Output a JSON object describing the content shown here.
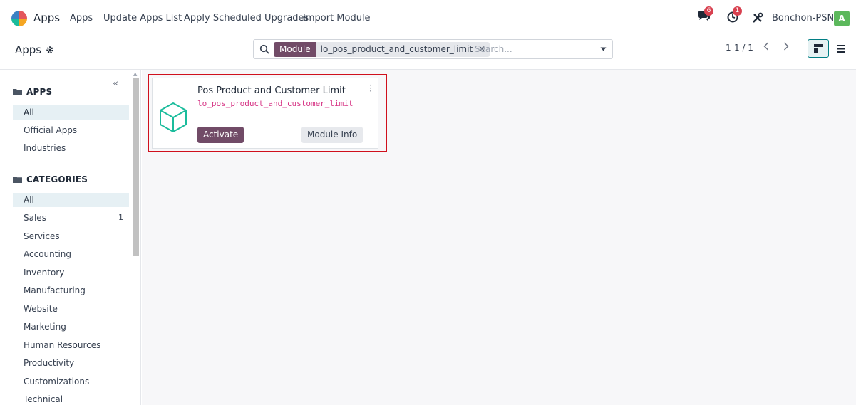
{
  "navbar": {
    "brand": "Apps",
    "menu": [
      "Apps",
      "Update Apps List",
      "Apply Scheduled Upgrades",
      "Import Module"
    ],
    "messages_badge": "6",
    "activities_badge": "1",
    "company": "Bonchon-PSN",
    "avatar_letter": "A"
  },
  "control": {
    "breadcrumb": "Apps",
    "search": {
      "facet_label": "Module",
      "facet_value": "lo_pos_product_and_customer_limit",
      "placeholder": "Search..."
    },
    "pager": "1-1 / 1"
  },
  "sidebar": {
    "apps_title": "APPS",
    "apps_items": [
      "All",
      "Official Apps",
      "Industries"
    ],
    "categories_title": "CATEGORIES",
    "category_items": [
      {
        "label": "All",
        "count": ""
      },
      {
        "label": "Sales",
        "count": "1"
      },
      {
        "label": "Services",
        "count": ""
      },
      {
        "label": "Accounting",
        "count": ""
      },
      {
        "label": "Inventory",
        "count": ""
      },
      {
        "label": "Manufacturing",
        "count": ""
      },
      {
        "label": "Website",
        "count": ""
      },
      {
        "label": "Marketing",
        "count": ""
      },
      {
        "label": "Human Resources",
        "count": ""
      },
      {
        "label": "Productivity",
        "count": ""
      },
      {
        "label": "Customizations",
        "count": ""
      },
      {
        "label": "Technical",
        "count": ""
      }
    ]
  },
  "card": {
    "title": "Pos Product and Customer Limit",
    "technical_name": "lo_pos_product_and_customer_limit",
    "activate_label": "Activate",
    "info_label": "Module Info"
  },
  "colors": {
    "primary": "#714b67",
    "highlight_border": "#d0101d",
    "module_icon": "#1abc9c",
    "badge": "#d8404f"
  }
}
